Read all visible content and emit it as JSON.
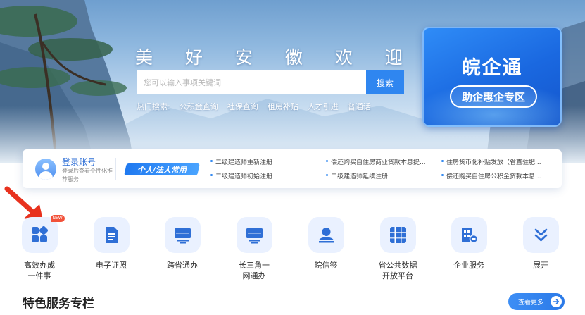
{
  "hero": {
    "slogan": "美 好 安 徽 欢 迎 您",
    "search_placeholder": "您可以输入事项关键词",
    "search_button": "搜索",
    "hot_label": "热门搜索:",
    "hot_links": [
      "公积金查询",
      "社保查询",
      "租房补贴",
      "人才引进",
      "普通话"
    ]
  },
  "promo": {
    "title": "皖企通",
    "button": "助企惠企专区"
  },
  "quickbar": {
    "login_title": "登录账号",
    "login_subtitle": "登录后查看个性化推荐服务",
    "badge": "个人/法人常用",
    "links": [
      "二级建造师重新注册",
      "偿还购买自住房商业贷款本息提...",
      "住房货币化补贴发放（省直驻肥...",
      "二级建造师初始注册",
      "二级建造师延续注册",
      "偿还购买自住房公积金贷款本息..."
    ]
  },
  "services": [
    {
      "label": "高效办成一件事",
      "icon": "grid-apps-icon",
      "tag": "NEW"
    },
    {
      "label": "电子证照",
      "icon": "document-icon"
    },
    {
      "label": "跨省通办",
      "icon": "monitor-icon"
    },
    {
      "label": "长三角一网通办",
      "icon": "monitor-icon"
    },
    {
      "label": "皖信签",
      "icon": "user-sign-icon"
    },
    {
      "label": "省公共数据开放平台",
      "icon": "data-platform-icon"
    },
    {
      "label": "企业服务",
      "icon": "enterprise-icon"
    },
    {
      "label": "展开",
      "icon": "chevron-double-down-icon"
    }
  ],
  "section": {
    "title": "特色服务专栏",
    "more": "查看更多"
  },
  "colors": {
    "primary": "#2f86f0",
    "promo_bg": "#1a68e0",
    "icon_bg": "#eaf1ff",
    "icon_fg": "#2f6fd6",
    "arrow": "#e8321e"
  }
}
